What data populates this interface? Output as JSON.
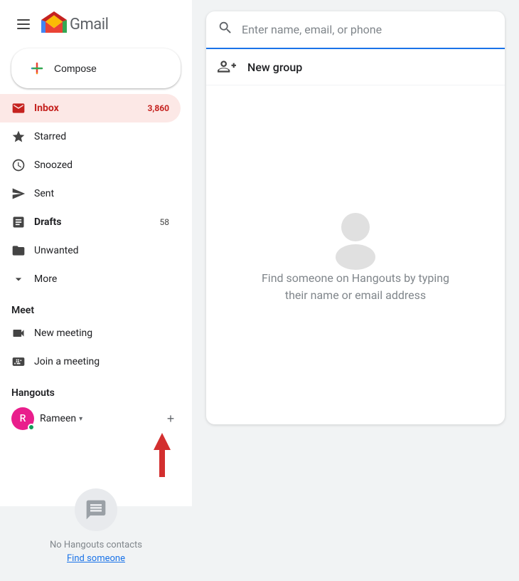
{
  "app": {
    "title": "Gmail",
    "logo_letter": "M"
  },
  "sidebar": {
    "compose_label": "Compose",
    "nav_items": [
      {
        "id": "inbox",
        "label": "Inbox",
        "badge": "3,860",
        "active": true,
        "icon": "inbox"
      },
      {
        "id": "starred",
        "label": "Starred",
        "badge": "",
        "active": false,
        "icon": "star"
      },
      {
        "id": "snoozed",
        "label": "Snoozed",
        "badge": "",
        "active": false,
        "icon": "clock"
      },
      {
        "id": "sent",
        "label": "Sent",
        "badge": "",
        "active": false,
        "icon": "send"
      },
      {
        "id": "drafts",
        "label": "Drafts",
        "badge": "58",
        "active": false,
        "icon": "drafts"
      },
      {
        "id": "unwanted",
        "label": "Unwanted",
        "badge": "",
        "active": false,
        "icon": "folder"
      },
      {
        "id": "more",
        "label": "More",
        "badge": "",
        "active": false,
        "icon": "chevron-down"
      }
    ],
    "meet_section": "Meet",
    "meet_items": [
      {
        "id": "new-meeting",
        "label": "New meeting",
        "icon": "video"
      },
      {
        "id": "join-meeting",
        "label": "Join a meeting",
        "icon": "keyboard"
      }
    ],
    "hangouts_section": "Hangouts",
    "hangouts_user": {
      "name": "Rameen",
      "initial": "R"
    },
    "no_contacts_text": "No Hangouts contacts",
    "find_someone_label": "Find someone"
  },
  "search": {
    "placeholder": "Enter name, email, or phone"
  },
  "new_group": {
    "label": "New group"
  },
  "empty_state": {
    "text": "Find someone on Hangouts by typing\ntheir name or email address"
  }
}
